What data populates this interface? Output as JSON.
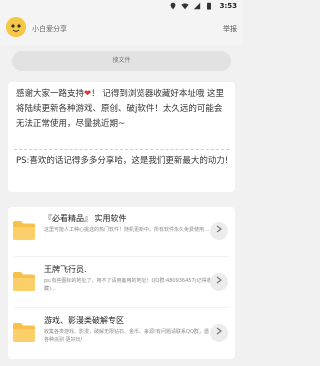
{
  "status_bar": {
    "time": "3:53"
  },
  "header": {
    "app_name": "小白爱分享",
    "right_link": "举报"
  },
  "search": {
    "placeholder": "搜文件"
  },
  "notice": {
    "part1": "感谢大家一路支持",
    "heart": "❤",
    "part2": "！ 记得到浏览器收藏好本址哦 这里将陆续更新各种游戏、原创、破j软件！太久远的可能会无法正常使用，尽量挑近期~",
    "ps": "PS:喜欢的话记得多多分享哈，这是我们更新最大的动力!"
  },
  "list": {
    "items": [
      {
        "title": "『必看精品』 实用软件",
        "desc": "这里可能人工种心挑选的热门软件！随机更新中，所有软件永久免费使用…"
      },
      {
        "title": "王牌飞行员.",
        "desc": "ps:有些图标的地址了，用不了请用备用的地址！QQ群:480936457(记得收藏)..."
      },
      {
        "title": "游戏、影漫类破解专区",
        "desc": "收集各类游戏、影漫，破解无限钻石、金币、来源!有问题请联系QQ群，遇各种派别 更好玩!"
      }
    ]
  }
}
